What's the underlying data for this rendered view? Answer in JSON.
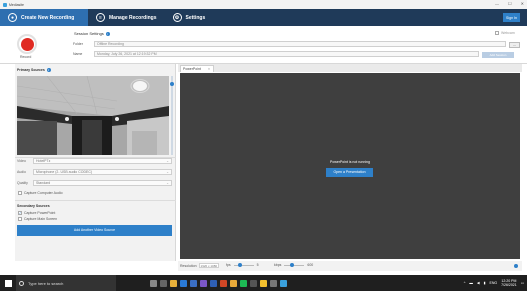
{
  "window": {
    "title": "Mediasite",
    "controls": [
      "—",
      "☐",
      "✕"
    ]
  },
  "nav": {
    "create": "Create New Recording",
    "manage": "Manage Recordings",
    "settings": "Settings",
    "signin": "Sign In"
  },
  "session": {
    "title": "Session Settings",
    "folder_label": "Folder",
    "folder_value": "Offline Recording",
    "name_label": "Name",
    "name_value": "Monday, July 26, 2021 at 12:19:32 PM",
    "record_label": "Record",
    "webcam_label": "Webcam",
    "dots": "...",
    "add_label": "Add Session"
  },
  "primary": {
    "title": "Primary Sources",
    "video_label": "Video",
    "video_value": "HotelPTz",
    "audio_label": "Audio",
    "audio_value": "Microphone (2- USB audio CODEC)",
    "quality_label": "Quality",
    "quality_value": "Standard",
    "capture_audio": "Capture Computer Audio"
  },
  "secondary": {
    "title": "Secondary Sources",
    "capture_ppt": "Capture PowerPoint",
    "capture_main": "Capture Main Screen",
    "add_video": "Add Another Video Source"
  },
  "ppt": {
    "tab": "PowerPoint",
    "message": "PowerPoint is not running",
    "open_button": "Open a Presentation",
    "resolution_label": "Resolution",
    "resolution_value": "1920 x 1080",
    "fps_label": "fps",
    "fps_value": "5",
    "kbps_label": "kbps",
    "kbps_value": "600"
  },
  "taskbar": {
    "search_placeholder": "Type here to search",
    "time": "12:20 PM",
    "date": "7/26/2021"
  },
  "colors": {
    "nav_bg": "#1f3a59",
    "accent": "#2e80c9",
    "record_red": "#e02a22",
    "ppt_bg": "#3f3f3f"
  }
}
